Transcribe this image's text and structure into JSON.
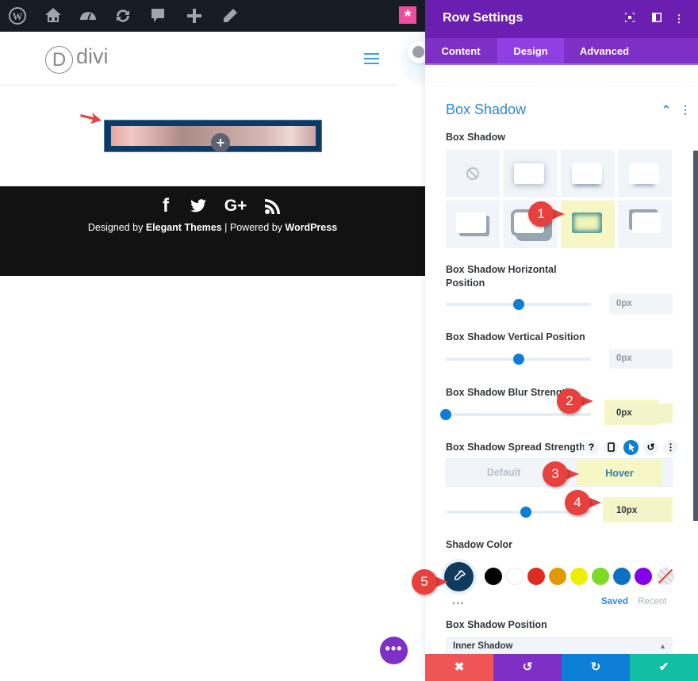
{
  "admin_bar": {
    "icons": [
      "wordpress-icon",
      "my-sites-icon",
      "dashboard-icon",
      "updates-icon",
      "comments-icon",
      "new-content-icon",
      "edit-icon"
    ],
    "badge": "*"
  },
  "site": {
    "logo_letter": "D",
    "logo_text": "divi",
    "menu_icon": "hamburger-icon"
  },
  "footer": {
    "social": [
      "f",
      "G+"
    ],
    "designed_by": "Designed by ",
    "designer": "Elegant Themes",
    "separator": " | Powered by ",
    "platform": "WordPress"
  },
  "panel": {
    "title": "Row Settings",
    "tabs": [
      {
        "label": "Content",
        "active": false
      },
      {
        "label": "Design",
        "active": true
      },
      {
        "label": "Advanced",
        "active": false
      }
    ],
    "section_title": "Box Shadow",
    "box_shadow_label": "Box Shadow",
    "presets_selected_index": 6,
    "horizontal": {
      "label_1": "Box Shadow Horizontal",
      "label_2": "Position",
      "value": "0px",
      "slider_fraction": 0.5
    },
    "vertical": {
      "label": "Box Shadow Vertical Position",
      "value": "0px",
      "slider_fraction": 0.5
    },
    "blur": {
      "label": "Box Shadow Blur Strength",
      "value": "0px",
      "slider_fraction": 0.0
    },
    "spread": {
      "label": "Box Shadow Spread Strength",
      "value": "10px",
      "slider_fraction": 0.55,
      "icons": [
        "?",
        "▯",
        "➤",
        "↺",
        "⋮"
      ],
      "modes": {
        "default": "Default",
        "hover": "Hover"
      }
    },
    "shadow_color": {
      "label": "Shadow Color",
      "current": "#0f3a5e",
      "swatches": [
        "#000000",
        "#ffffff",
        "#e02b20",
        "#e09900",
        "#edf000",
        "#7cda24",
        "#0c71c3",
        "#8300e9"
      ],
      "saved": "Saved",
      "recent": "Recent",
      "more": "•••"
    },
    "position": {
      "label": "Box Shadow Position",
      "value": "Inner Shadow"
    },
    "actions": {
      "cancel": "✖",
      "undo": "↺",
      "redo": "↻",
      "save": "✔"
    }
  },
  "callouts": [
    "1",
    "2",
    "3",
    "4",
    "5"
  ],
  "fab": "•••",
  "colors": {
    "purple_header": "#6b1fb1",
    "accent_blue": "#2b87da",
    "cancel": "#ef5555",
    "undo": "#7e2fc6",
    "redo": "#0c7ed6",
    "save": "#11c0a4"
  }
}
